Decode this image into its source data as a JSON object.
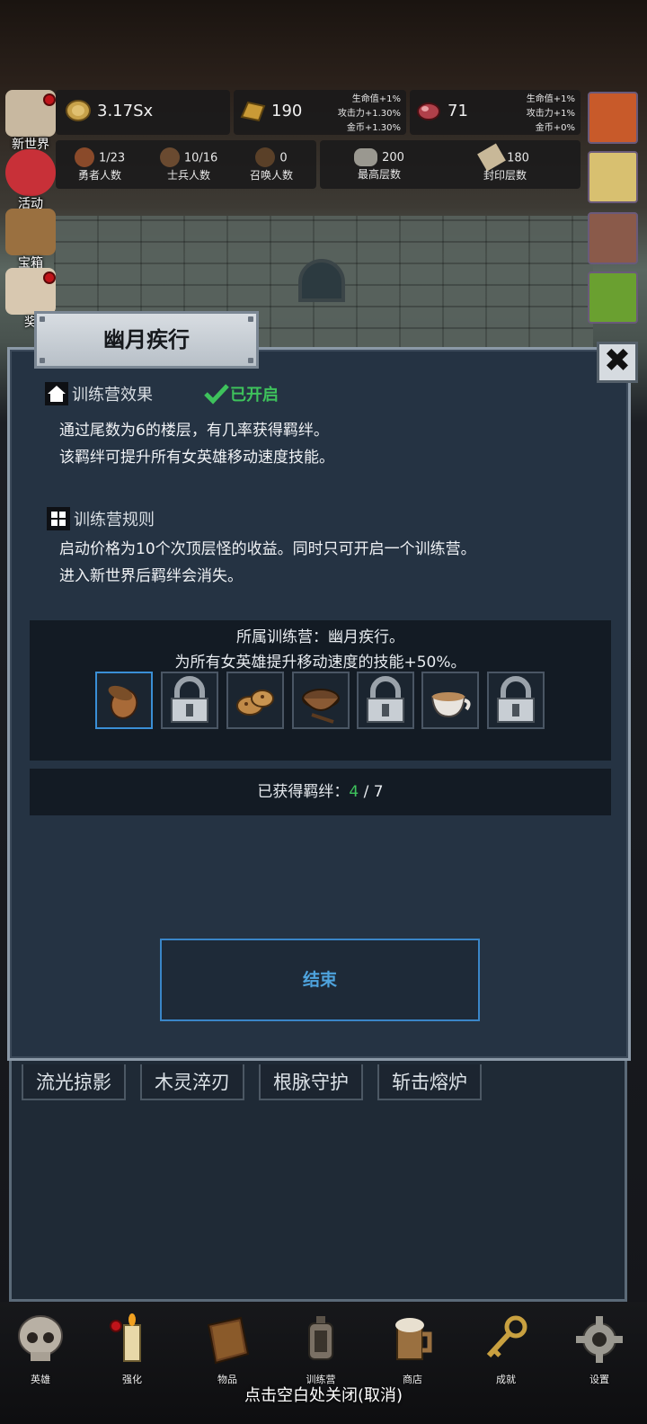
{
  "resources": {
    "coin": "3.17Sx",
    "bar": "190",
    "bar_bonus": [
      "生命值+1%",
      "攻击力+1.30%",
      "金币+1.30%"
    ],
    "gem": "71",
    "gem_bonus": [
      "生命值+1%",
      "攻击力+1%",
      "金币+0%"
    ]
  },
  "stats": [
    {
      "value": "1/23",
      "label": "勇者人数"
    },
    {
      "value": "10/16",
      "label": "士兵人数"
    },
    {
      "value": "0",
      "label": "召唤人数"
    },
    {
      "value": "200",
      "label": "最高层数"
    },
    {
      "value": "180",
      "label": "封印层数"
    }
  ],
  "side_menu": [
    "新世界",
    "活动",
    "宝箱",
    "奖"
  ],
  "under_panel": {
    "tags": [
      "流光掠影",
      "木灵淬刃",
      "根脉守护",
      "斩击熔炉"
    ]
  },
  "bottom_nav": [
    "英雄",
    "强化",
    "物品",
    "训练营",
    "商店",
    "成就",
    "设置"
  ],
  "close_hint": "点击空白处关闭(取消)",
  "dialog": {
    "title": "幽月疾行",
    "close_label": "✖",
    "effect_title": "训练营效果",
    "status": "已开启",
    "effect_lines": [
      "通过尾数为6的楼层，有几率获得羁绊。",
      "该羁绊可提升所有女英雄移动速度技能。"
    ],
    "rules_title": "训练营规则",
    "rules_lines": [
      "启动价格为10个次顶层怪的收益。同时只可开启一个训练营。",
      "进入新世界后羁绊会消失。"
    ],
    "camp_line": "所属训练营：幽月疾行。",
    "bonus_line": "为所有女英雄提升移动速度的技能+50%。",
    "slots": [
      {
        "item": "acorn-icon",
        "locked": false,
        "selected": true
      },
      {
        "item": "lock-icon",
        "locked": true,
        "selected": false
      },
      {
        "item": "cookies-icon",
        "locked": false,
        "selected": false
      },
      {
        "item": "cocoa-bowl-icon",
        "locked": false,
        "selected": false
      },
      {
        "item": "lock-icon",
        "locked": true,
        "selected": false
      },
      {
        "item": "coffee-cup-icon",
        "locked": false,
        "selected": false
      },
      {
        "item": "lock-icon",
        "locked": true,
        "selected": false
      }
    ],
    "count_label": "已获得羁绊：",
    "count_value": "4",
    "count_total": " / 7",
    "end_button": "结束"
  }
}
